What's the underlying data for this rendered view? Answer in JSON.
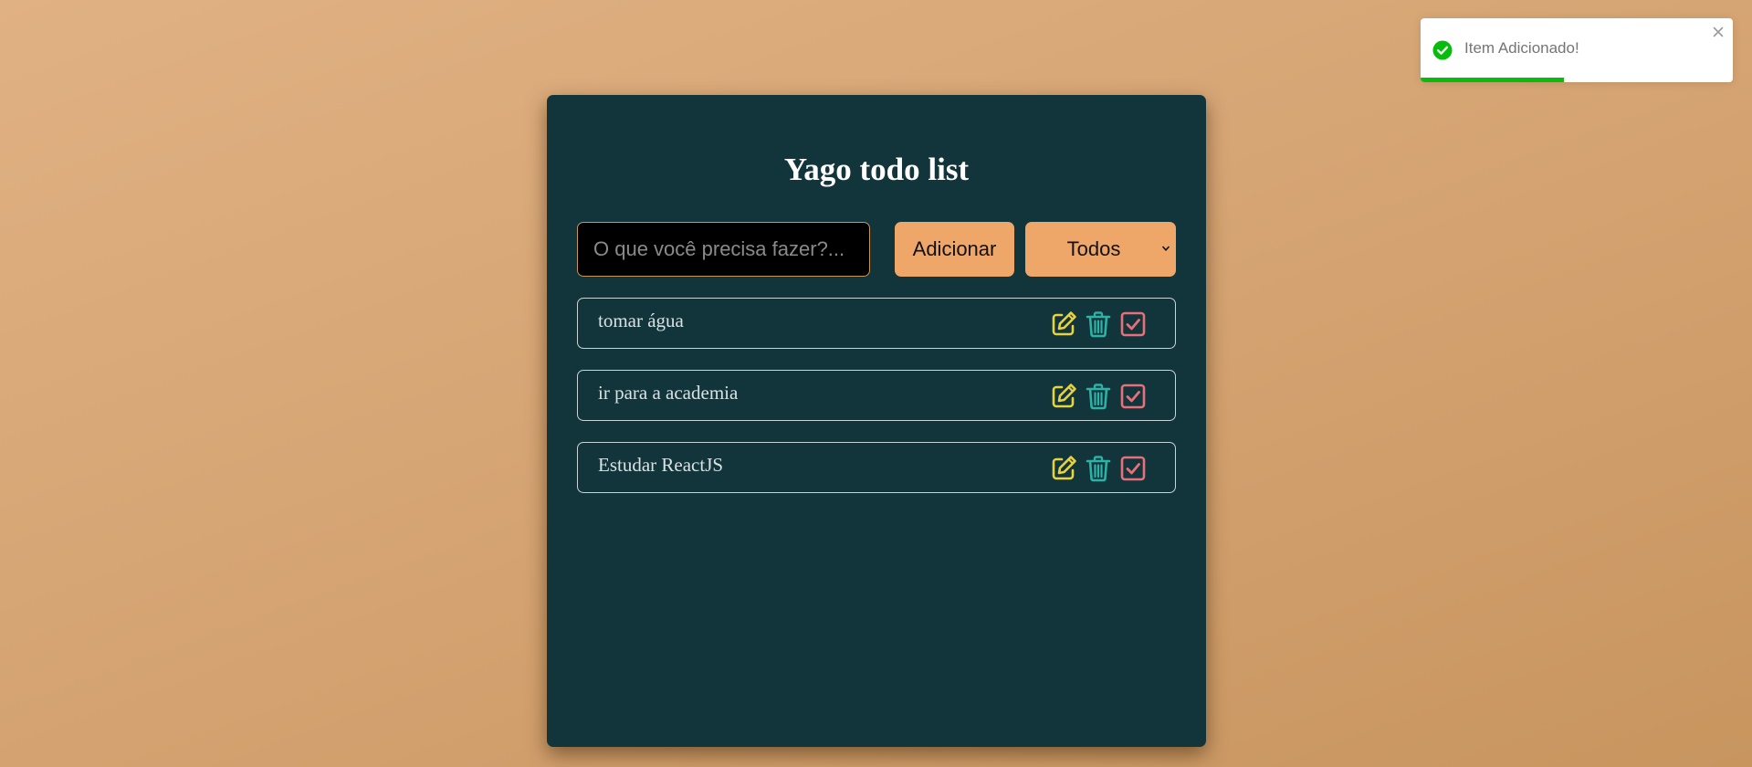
{
  "app": {
    "title": "Yago todo list"
  },
  "form": {
    "input_placeholder": "O que você precisa fazer?...",
    "input_value": "",
    "add_label": "Adicionar",
    "filter_selected": "Todos"
  },
  "todos": [
    {
      "text": "tomar água"
    },
    {
      "text": "ir para a academia"
    },
    {
      "text": "Estudar ReactJS"
    }
  ],
  "icons": {
    "edit": "edit-icon",
    "delete": "trash-icon",
    "complete": "checkbox-check-icon"
  },
  "toast": {
    "message": "Item Adicionado!",
    "progress_fraction": 0.46
  },
  "colors": {
    "background": "#d6a574",
    "card": "#12343b",
    "accent": "#efa769",
    "edit_icon": "#e8d43a",
    "delete_icon": "#2ab3a6",
    "complete_icon": "#e8707a",
    "toast_success": "#07bc0c"
  }
}
